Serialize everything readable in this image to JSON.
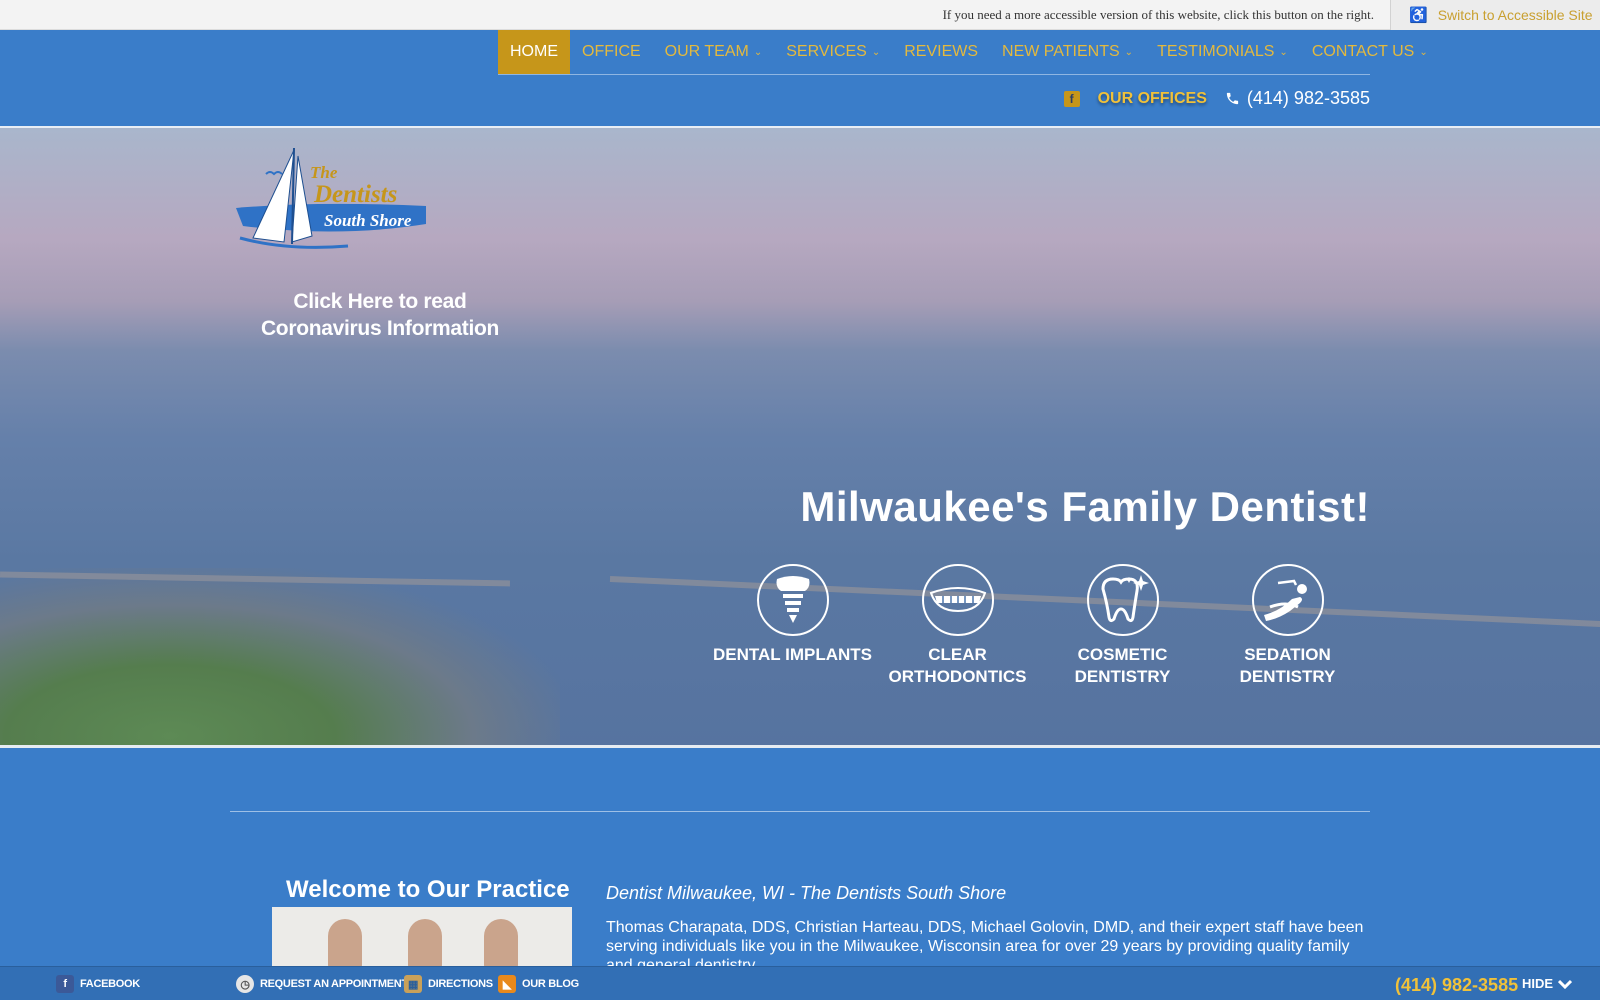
{
  "accessibility": {
    "notice": "If you need a more accessible version of this website, click this button on the right.",
    "button_label": "Switch to Accessible Site"
  },
  "nav": {
    "items": [
      {
        "label": "HOME",
        "dropdown": false,
        "active": true
      },
      {
        "label": "OFFICE",
        "dropdown": false,
        "active": false
      },
      {
        "label": "OUR TEAM",
        "dropdown": true,
        "active": false
      },
      {
        "label": "SERVICES",
        "dropdown": true,
        "active": false
      },
      {
        "label": "REVIEWS",
        "dropdown": false,
        "active": false
      },
      {
        "label": "NEW PATIENTS",
        "dropdown": true,
        "active": false
      },
      {
        "label": "TESTIMONIALS",
        "dropdown": true,
        "active": false
      },
      {
        "label": "CONTACT US",
        "dropdown": true,
        "active": false
      }
    ],
    "facebook_glyph": "f",
    "offices_label": "OUR OFFICES",
    "phone": "(414) 982-3585"
  },
  "hero": {
    "logo": {
      "the": "The",
      "dentists": "Dentists",
      "south_shore": "South Shore"
    },
    "covid_line1": "Click Here to read",
    "covid_line2": "Coronavirus Information",
    "tagline": "Milwaukee's Family Dentist!",
    "services": [
      {
        "line1": "DENTAL IMPLANTS",
        "line2": "",
        "icon": "dental-implant-icon"
      },
      {
        "line1": "CLEAR",
        "line2": "ORTHODONTICS",
        "icon": "teeth-icon"
      },
      {
        "line1": "COSMETIC",
        "line2": "DENTISTRY",
        "icon": "sparkle-tooth-icon"
      },
      {
        "line1": "SEDATION",
        "line2": "DENTISTRY",
        "icon": "dental-chair-icon"
      }
    ]
  },
  "welcome": {
    "heading": "Welcome to Our Practice",
    "intro_title": "Dentist Milwaukee, WI - The Dentists South Shore",
    "intro_body": "Thomas Charapata, DDS, Christian Harteau, DDS, Michael Golovin, DMD, and their expert staff have been serving individuals like you in the Milwaukee, Wisconsin area for over 29 years by providing quality family and general dentistry."
  },
  "bottom_bar": {
    "facebook": "FACEBOOK",
    "appointment": "REQUEST AN APPOINTMENT",
    "directions": "DIRECTIONS",
    "blog": "OUR BLOG",
    "phone": "(414) 982-3585",
    "hide": "HIDE"
  },
  "colors": {
    "primary_blue": "#3a7dc9",
    "gold": "#c6961a",
    "nav_text": "#e3b93e"
  }
}
